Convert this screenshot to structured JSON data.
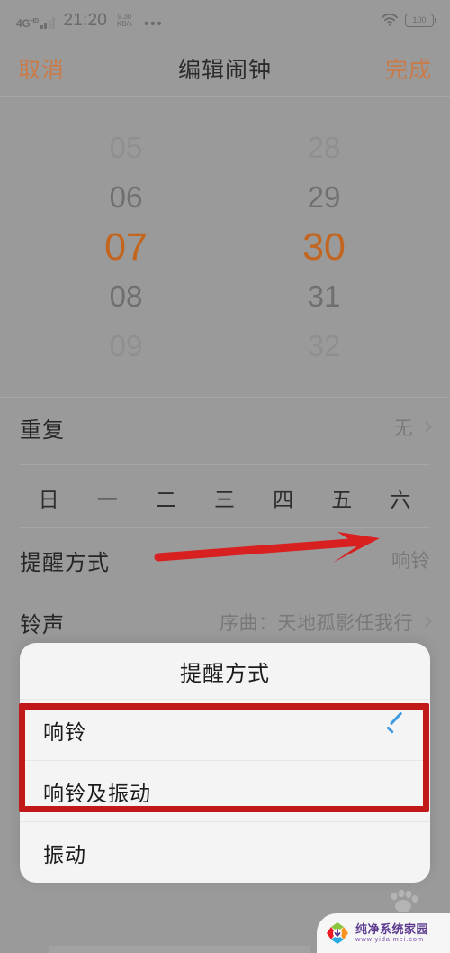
{
  "status_bar": {
    "network": "4G",
    "network_sup": "HD",
    "time": "21:20",
    "speed_value": "9.30",
    "speed_unit": "KB/s",
    "overflow_icon": "•••",
    "wifi_icon": "wifi-icon",
    "battery_level": "100"
  },
  "nav": {
    "cancel_label": "取消",
    "title": "编辑闹钟",
    "done_label": "完成"
  },
  "time_picker": {
    "hours": [
      "05",
      "06",
      "07",
      "08",
      "09"
    ],
    "minutes": [
      "28",
      "29",
      "30",
      "31",
      "32"
    ],
    "selected_hour": "07",
    "selected_minute": "30",
    "selected_color": "#c4651f"
  },
  "rows": {
    "repeat": {
      "label": "重复",
      "value": "无"
    },
    "weekdays": [
      "日",
      "一",
      "二",
      "三",
      "四",
      "五",
      "六"
    ],
    "reminder": {
      "label": "提醒方式",
      "value": "响铃"
    },
    "ringtone": {
      "label": "铃声",
      "value": "序曲：天地孤影任我行"
    }
  },
  "dialog": {
    "title": "提醒方式",
    "options": [
      {
        "label": "响铃",
        "checked": true
      },
      {
        "label": "响铃及振动",
        "checked": false
      },
      {
        "label": "振动",
        "checked": false
      }
    ],
    "check_color": "#3d9ae0"
  },
  "annotations": {
    "arrow_color": "#d92020",
    "box_color": "#c1181a"
  },
  "watermark": {
    "name": "纯净系统家园",
    "url": "www.yidaimei.com"
  }
}
